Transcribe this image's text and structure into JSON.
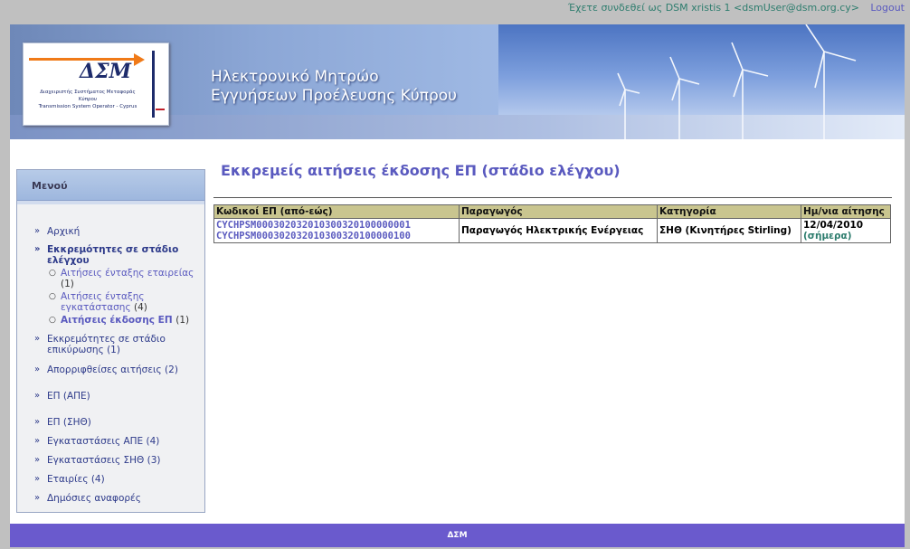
{
  "topbar": {
    "logged_in_text": "Έχετε συνδεθεί ως DSM xristis 1 <dsmUser@dsm.org.cy>",
    "logout_label": "Logout"
  },
  "banner": {
    "logo_mark": "ΔΣΜ",
    "logo_line_1": "Διαχειριστής Συστήματος Μεταφοράς",
    "logo_line_2": "Κύπρου",
    "logo_line_3": "Transmission System Operator - Cyprus",
    "title_line_1": "Ηλεκτρονικό Μητρώο",
    "title_line_2": "Εγγυήσεων Προέλευσης Κύπρου"
  },
  "sidebar": {
    "header": "Μενού",
    "items": {
      "home": "Αρχική",
      "pending_check": "Εκκρεμότητες σε στάδιο ελέγχου",
      "sub_company": "Αιτήσεις ένταξης εταιρείας",
      "sub_company_count": "(1)",
      "sub_install": "Αιτήσεις ένταξης εγκατάστασης",
      "sub_install_count": "(4)",
      "sub_issue": "Αιτήσεις έκδοσης ΕΠ",
      "sub_issue_count": "(1)",
      "pending_confirm": "Εκκρεμότητες σε στάδιο επικύρωσης (1)",
      "rejected": "Απορριφθείσες αιτήσεις (2)",
      "ep_ape": "ΕΠ (ΑΠΕ)",
      "ep_sith": "ΕΠ (ΣΗΘ)",
      "installs_ape": "Εγκαταστάσεις ΑΠΕ (4)",
      "installs_sith": "Εγκαταστάσεις ΣΗΘ (3)",
      "companies": "Εταιρίες (4)",
      "public_reports": "Δημόσιες αναφορές"
    }
  },
  "main": {
    "heading": "Εκκρεμείς αιτήσεις έκδοσης ΕΠ (στάδιο ελέγχου)",
    "table": {
      "headers": [
        "Κωδικοί ΕΠ (από-εώς)",
        "Παραγωγός",
        "Κατηγορία",
        "Ημ/νια αίτησης"
      ],
      "rows": [
        {
          "code_from": "CYCHPSM000302032010300320100000001",
          "code_to": "CYCHPSM000302032010300320100000100",
          "producer": "Παραγωγός Ηλεκτρικής Ενέργειας",
          "category": "ΣΗΘ (Κινητήρες Stirling)",
          "date": "12/04/2010",
          "date_note": "(σήμερα)"
        }
      ]
    }
  },
  "footer": {
    "text": "ΔΣΜ"
  }
}
